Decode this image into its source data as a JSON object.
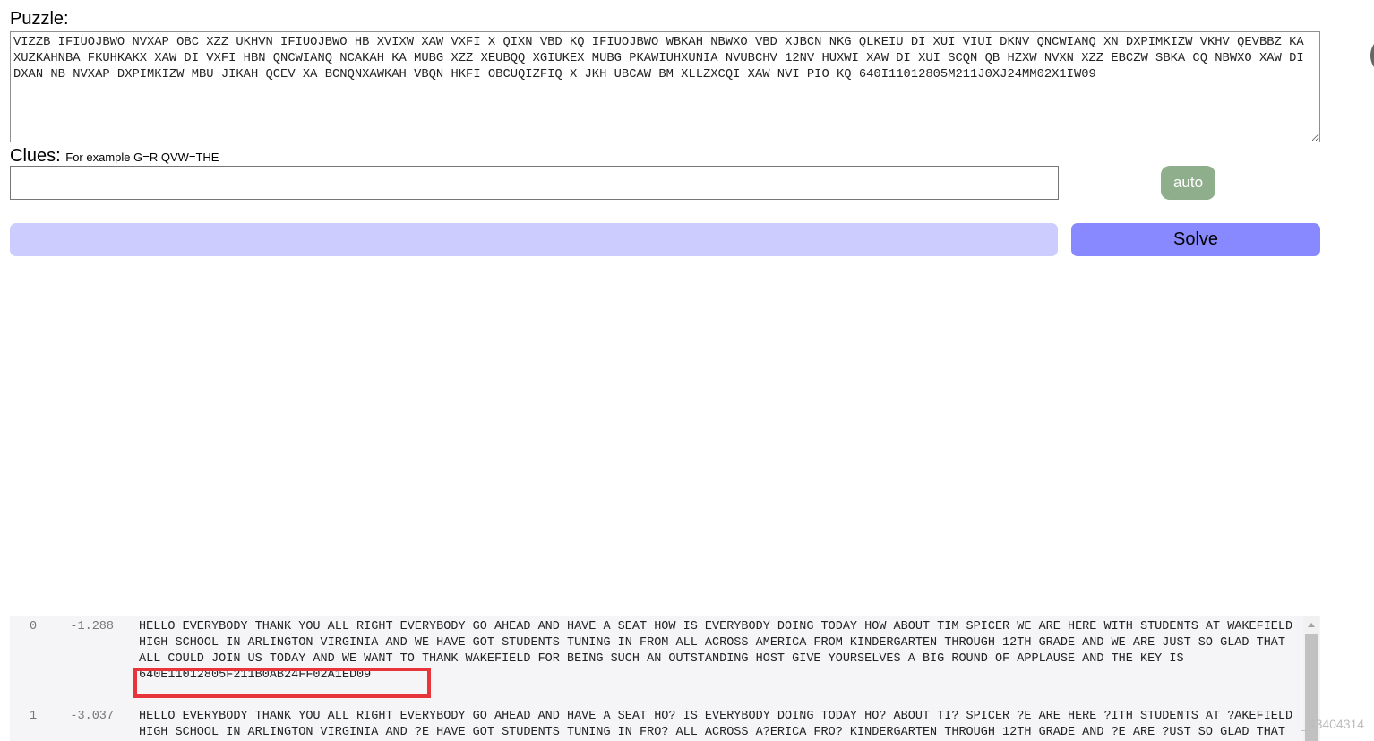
{
  "puzzle": {
    "label": "Puzzle:",
    "text": "VIZZB IFIUOJBWO NVXAP OBC XZZ UKHVN IFIUOJBWO HB XVIXW XAW VXFI X QIXN VBD KQ IFIUOJBWO WBKAH NBWXO VBD XJBCN NKG QLKEIU DI XUI VIUI DKNV QNCWIANQ XN DXPIMKIZW VKHV QEVBBZ KA XUZKAHNBA FKUHKAKX XAW DI VXFI HBN QNCWIANQ NCAKAH KA MUBG XZZ XEUBQQ XGIUKEX MUBG PKAWIUHXUNIA NVUBCHV 12NV HUXWI XAW DI XUI SCQN QB HZXW NVXN XZZ EBCZW SBKA CQ NBWXO XAW DI DXAN NB NVXAP DXPIMKIZW MBU JIKAH QCEV XA BCNQNXAWKAH VBQN HKFI OBCUQIZFIQ X JKH UBCAW BM XLLZXCQI XAW NVI PIO KQ 640I11012805M211J0XJ24MM02X1IW09"
  },
  "clues": {
    "label": "Clues:",
    "hint": "For example G=R QVW=THE",
    "value": ""
  },
  "buttons": {
    "auto": "auto",
    "solve": "Solve"
  },
  "results": [
    {
      "index": "0",
      "score": "-1.288",
      "text": "HELLO EVERYBODY THANK YOU ALL RIGHT EVERYBODY GO AHEAD AND HAVE A SEAT HOW IS EVERYBODY DOING TODAY HOW ABOUT TIM SPICER WE ARE HERE WITH STUDENTS AT WAKEFIELD HIGH SCHOOL IN ARLINGTON VIRGINIA AND WE HAVE GOT STUDENTS TUNING IN FROM ALL ACROSS AMERICA FROM KINDERGARTEN THROUGH 12TH GRADE AND WE ARE JUST SO GLAD THAT ALL COULD JOIN US TODAY AND WE WANT TO THANK WAKEFIELD FOR BEING SUCH AN OUTSTANDING HOST GIVE YOURSELVES A BIG ROUND OF APPLAUSE AND THE KEY IS 640E11012805F211B0AB24FF02A1ED09"
    },
    {
      "index": "1",
      "score": "-3.037",
      "text": "HELLO EVERYBODY THANK YOU ALL RIGHT EVERYBODY GO AHEAD AND HAVE A SEAT HO? IS EVERYBODY DOING TODAY HO? ABOUT TI? SPICER ?E ARE HERE ?ITH STUDENTS AT ?AKEFIELD HIGH SCHOOL IN ARLINGTON VIRGINIA AND ?E HAVE GOT STUDENTS TUNING IN FRO? ALL ACROSS A?ERICA FRO? KINDERGARTEN THROUGH 12TH GRADE AND ?E ARE ?UST SO GLAD THAT"
    }
  ],
  "watermark": "_43404314",
  "colors": {
    "auto_button": "#8fae8b",
    "progress_bar": "#ccccff",
    "solve_button": "#8888ff",
    "results_background": "#f5f5f7",
    "highlight_box": "#e8343b"
  }
}
